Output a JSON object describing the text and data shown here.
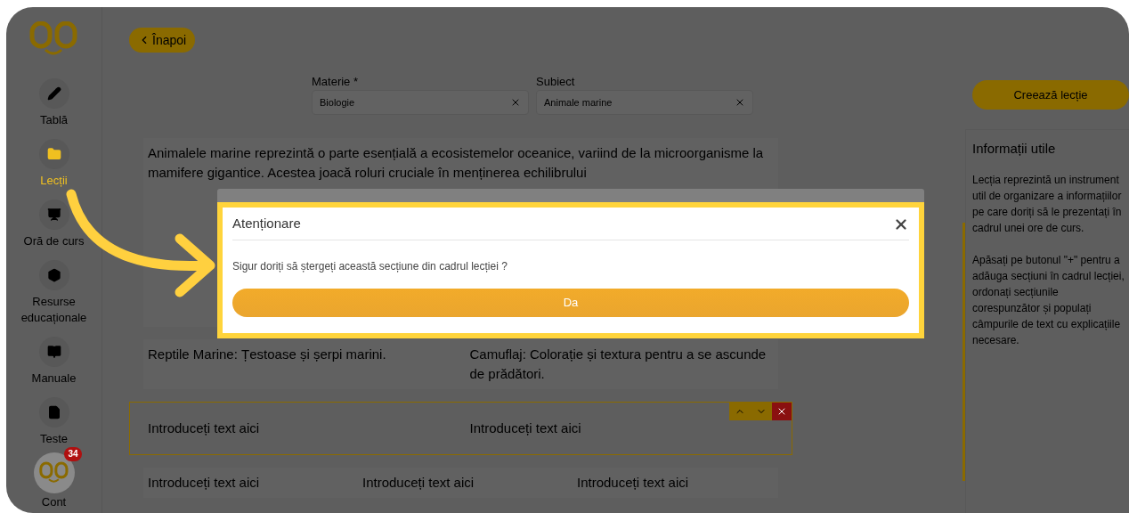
{
  "sidebar": {
    "items": [
      {
        "label": "Tablă",
        "selected": false
      },
      {
        "label": "Lecții",
        "selected": true
      },
      {
        "label": "Oră de curs",
        "selected": false
      },
      {
        "label": "Resurse educaționale",
        "selected": false
      },
      {
        "label": "Manuale",
        "selected": false
      },
      {
        "label": "Teste",
        "selected": false
      }
    ],
    "account": {
      "label": "Cont",
      "badge": "34"
    }
  },
  "back_button": "Înapoi",
  "fields": [
    {
      "label": "Materie *",
      "value": "Biologie"
    },
    {
      "label": "Subiect",
      "value": "Animale marine"
    }
  ],
  "sections": [
    {
      "columns": [
        "Animalele marine reprezintă o parte esențială a ecosistemelor oceanice, variind de la microorganisme la mamifere gigantice. Acestea joacă roluri cruciale în menținerea echilibrului"
      ],
      "selected": false
    },
    {
      "columns": [
        "Reptile Marine: Țestoase și șerpi marini.",
        "Camuflaj: Colorație și textura pentru a se ascunde de prădători."
      ],
      "selected": false
    },
    {
      "columns": [
        "Introduceți text aici",
        "Introduceți text aici"
      ],
      "selected": true
    },
    {
      "columns": [
        "Introduceți text aici",
        "Introduceți text aici",
        "Introduceți text aici"
      ],
      "selected": false
    }
  ],
  "create_button": "Creează lecție",
  "info_panel": {
    "title": "Informații utile",
    "paragraphs": [
      "Lecția reprezintă un instrument util de organizare a informațiilor pe care doriți să le prezentați în cadrul unei ore de curs.",
      "Apăsați pe butonul \"+\" pentru a adăuga secțiuni în cadrul lecției, ordonați secțiunile corespunzător și populați câmpurile de text cu explicațiile necesare."
    ]
  },
  "dialog": {
    "title": "Atenționare",
    "message": "Sigur doriți să ștergeți această secțiune din cadrul lecției ?",
    "confirm": "Da"
  }
}
